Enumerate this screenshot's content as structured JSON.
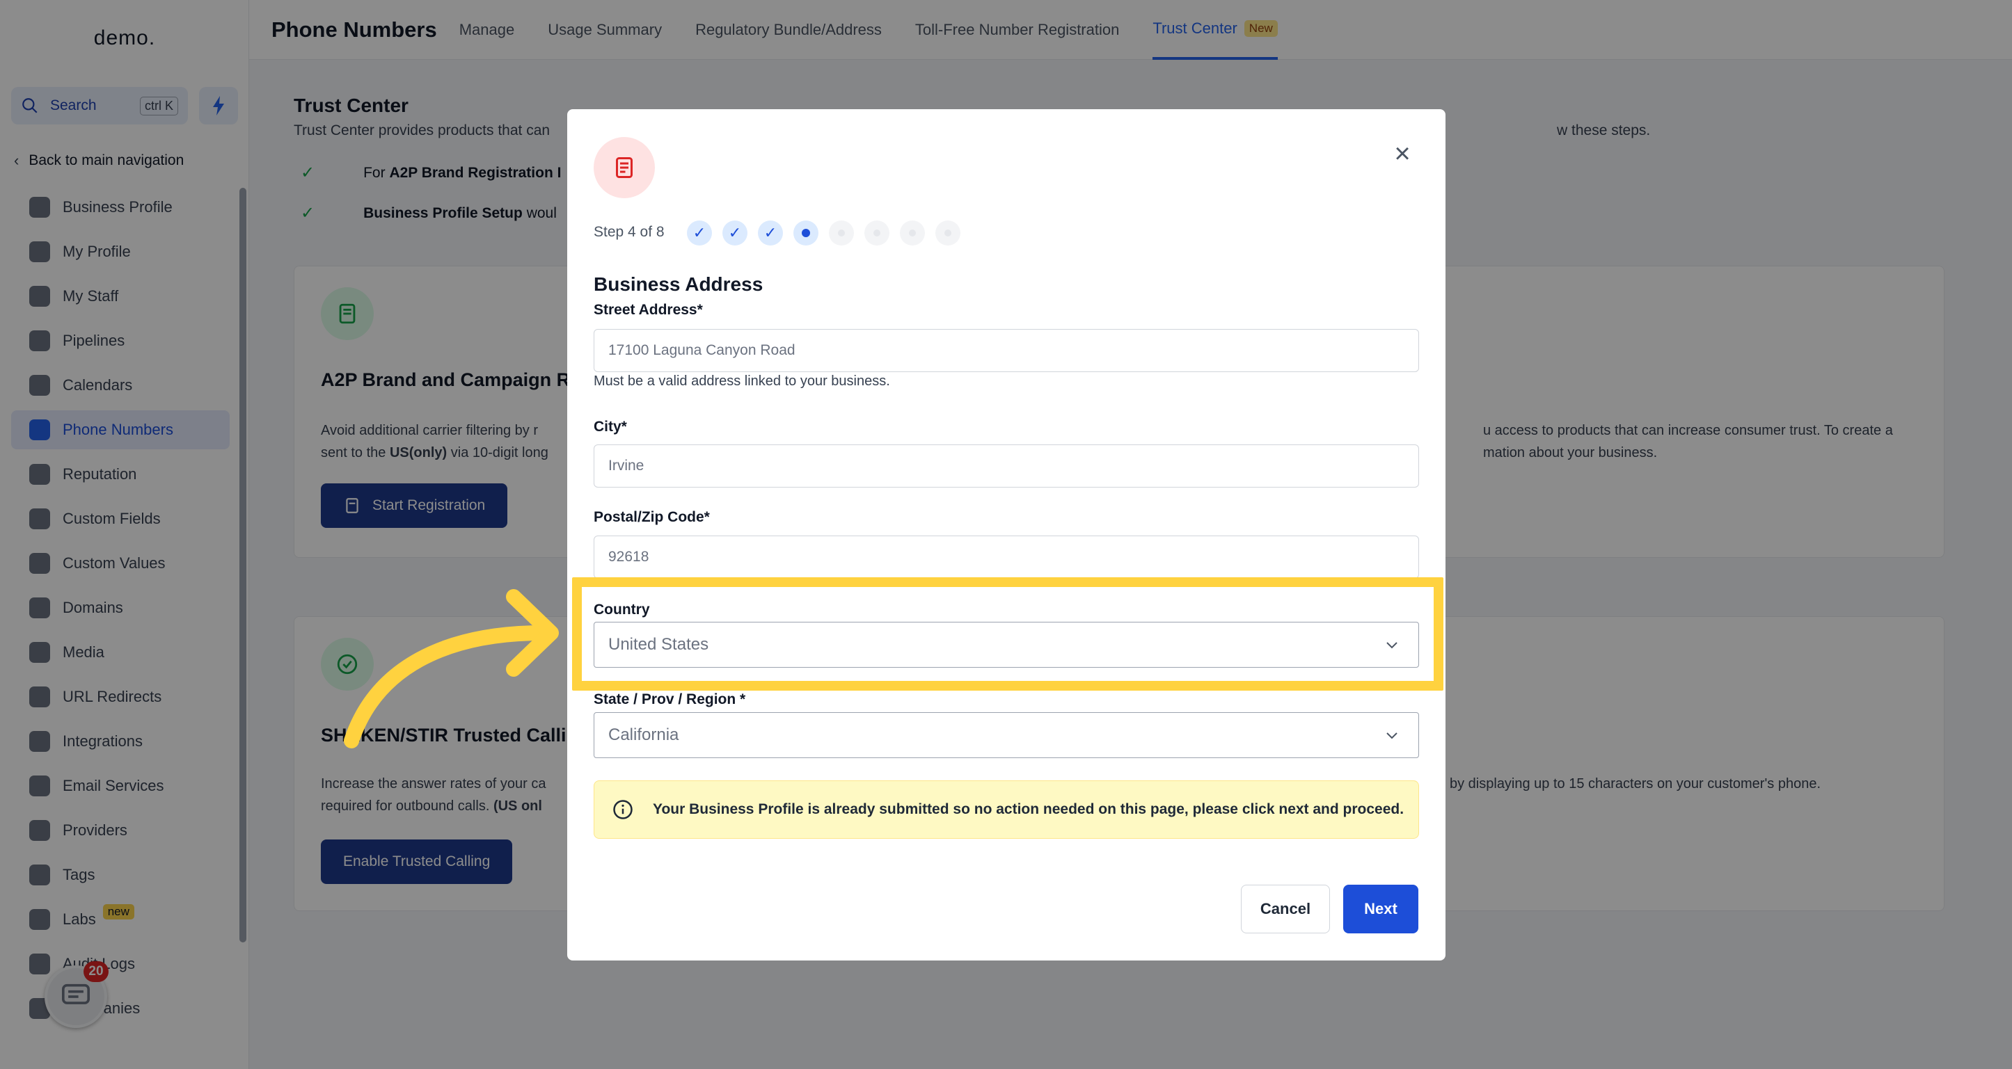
{
  "sidebar": {
    "logo": "demo.",
    "search_label": "Search",
    "search_shortcut": "ctrl K",
    "back_label": "Back to main navigation",
    "items": [
      {
        "label": "Business Profile"
      },
      {
        "label": "My Profile"
      },
      {
        "label": "My Staff"
      },
      {
        "label": "Pipelines"
      },
      {
        "label": "Calendars"
      },
      {
        "label": "Phone Numbers",
        "active": true
      },
      {
        "label": "Reputation"
      },
      {
        "label": "Custom Fields"
      },
      {
        "label": "Custom Values"
      },
      {
        "label": "Domains"
      },
      {
        "label": "Media"
      },
      {
        "label": "URL Redirects"
      },
      {
        "label": "Integrations"
      },
      {
        "label": "Email Services"
      },
      {
        "label": "Providers"
      },
      {
        "label": "Tags"
      },
      {
        "label": "Labs",
        "badge": "new"
      },
      {
        "label": "Audit Logs"
      },
      {
        "label": "Companies"
      }
    ],
    "chat_count": "20"
  },
  "header": {
    "title": "Phone Numbers",
    "tabs": [
      {
        "label": "Manage"
      },
      {
        "label": "Usage Summary"
      },
      {
        "label": "Regulatory Bundle/Address"
      },
      {
        "label": "Toll-Free Number Registration"
      },
      {
        "label": "Trust Center",
        "badge": "New",
        "active": true
      }
    ]
  },
  "trust_center": {
    "title": "Trust Center",
    "desc_start": "Trust Center provides products that can",
    "desc_end": "w these steps.",
    "check1_prefix": "For",
    "check1_bold": "A2P Brand Registration I",
    "check2_bold": "Business Profile Setup",
    "check2_text": "woul",
    "a2p_card": {
      "title": "A2P Brand and Campaign R",
      "text_line1": "Avoid additional carrier filtering by r",
      "text_line2_start": "sent to the",
      "text_line2_bold": "US(only)",
      "text_line2_end": "via 10-digit long",
      "right_line1": "u access to products that can increase consumer trust. To create a",
      "right_line2": "mation about your business.",
      "button": "Start Registration"
    },
    "shaken_card": {
      "title": "SHAKEN/STIR Trusted Calli",
      "text_line1": "Increase the answer rates of your ca",
      "text_line2_start": "required for outbound calls.",
      "text_line2_bold": "(US onl",
      "right_line1": "by displaying up to 15 characters on your customer's phone.",
      "button": "Enable Trusted Calling"
    }
  },
  "modal": {
    "step_label": "Step 4 of 8",
    "steps_completed": 3,
    "current_step": 4,
    "total_steps": 8,
    "section_title": "Business Address",
    "street": {
      "label": "Street Address*",
      "value": "17100 Laguna Canyon Road",
      "help": "Must be a valid address linked to your business."
    },
    "city": {
      "label": "City*",
      "value": "Irvine"
    },
    "postal": {
      "label": "Postal/Zip Code*",
      "value": "92618"
    },
    "country": {
      "label": "Country",
      "value": "United States"
    },
    "state": {
      "label": "State / Prov / Region *",
      "value": "California"
    },
    "notice": "Your Business Profile is already submitted so no action needed on this page, please click next and proceed.",
    "cancel": "Cancel",
    "next": "Next"
  },
  "colors": {
    "accent": "#1d4ed8",
    "highlight": "#ffd23f",
    "notice_bg": "#fef9c3"
  }
}
